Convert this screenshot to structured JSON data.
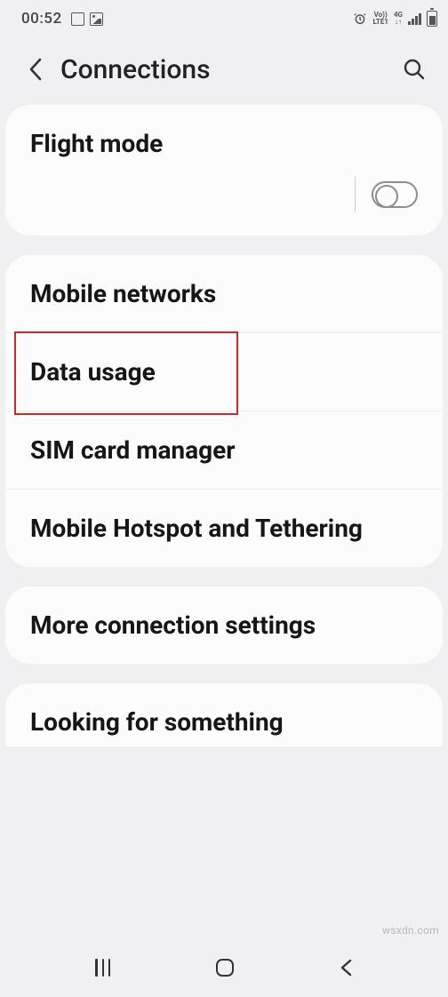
{
  "status": {
    "time": "00:52",
    "net1": "Vo))",
    "net2": "LTE1",
    "net3": "4G",
    "arrows": "↓↑"
  },
  "header": {
    "title": "Connections"
  },
  "flight": {
    "title": "Flight mode"
  },
  "network_group": {
    "mobile_networks": "Mobile networks",
    "data_usage": "Data usage",
    "sim_manager": "SIM card manager",
    "hotspot": "Mobile Hotspot and Tethering"
  },
  "more": {
    "title": "More connection settings"
  },
  "footer": {
    "title": "Looking for something"
  },
  "watermark": "wsxdn.com"
}
